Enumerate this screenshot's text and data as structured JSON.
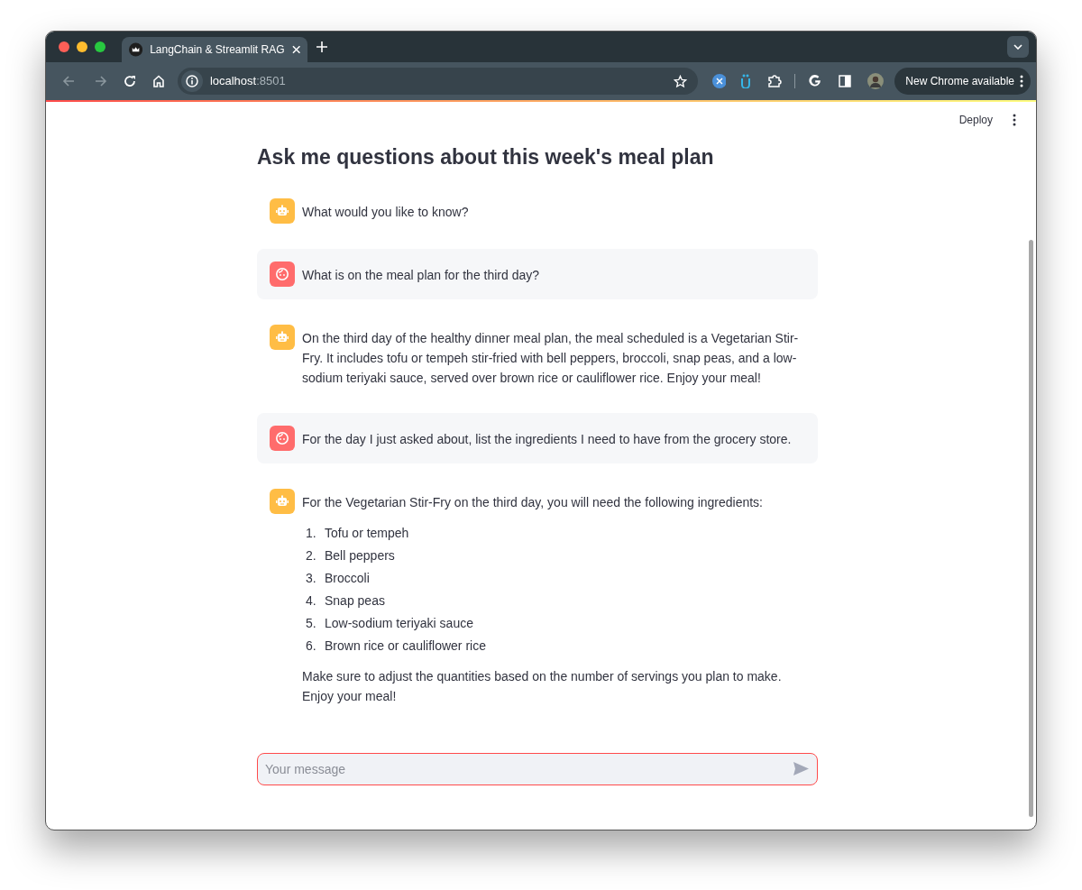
{
  "browser": {
    "tab_title": "LangChain & Streamlit RAG",
    "url_host": "localhost",
    "url_port": ":8501",
    "update_button": "New Chrome available"
  },
  "app": {
    "deploy_button": "Deploy",
    "title": "Ask me questions about this week's meal plan"
  },
  "messages": [
    {
      "kind": "assistant",
      "blocks": [
        {
          "kind": "paragraph",
          "text": "What would you like to know?"
        }
      ]
    },
    {
      "kind": "user",
      "blocks": [
        {
          "kind": "paragraph",
          "text": "What is on the meal plan for the third day?"
        }
      ]
    },
    {
      "kind": "assistant",
      "blocks": [
        {
          "kind": "paragraph",
          "text": "On the third day of the healthy dinner meal plan, the meal scheduled is a Vegetarian Stir-Fry. It includes tofu or tempeh stir-fried with bell peppers, broccoli, snap peas, and a low-sodium teriyaki sauce, served over brown rice or cauliflower rice. Enjoy your meal!"
        }
      ]
    },
    {
      "kind": "user",
      "blocks": [
        {
          "kind": "paragraph",
          "text": "For the day I just asked about, list the ingredients I need to have from the grocery store."
        }
      ]
    },
    {
      "kind": "assistant",
      "blocks": [
        {
          "kind": "paragraph",
          "text": "For the Vegetarian Stir-Fry on the third day, you will need the following ingredients:"
        },
        {
          "kind": "list",
          "items": [
            {
              "number": "1.",
              "text": "Tofu or tempeh"
            },
            {
              "number": "2.",
              "text": "Bell peppers"
            },
            {
              "number": "3.",
              "text": "Broccoli"
            },
            {
              "number": "4.",
              "text": "Snap peas"
            },
            {
              "number": "5.",
              "text": "Low-sodium teriyaki sauce"
            },
            {
              "number": "6.",
              "text": "Brown rice or cauliflower rice"
            }
          ]
        },
        {
          "kind": "paragraph",
          "text": "Make sure to adjust the quantities based on the number of servings you plan to make. Enjoy your meal!"
        }
      ]
    }
  ],
  "chat_input": {
    "placeholder": "Your message",
    "focused": true
  }
}
